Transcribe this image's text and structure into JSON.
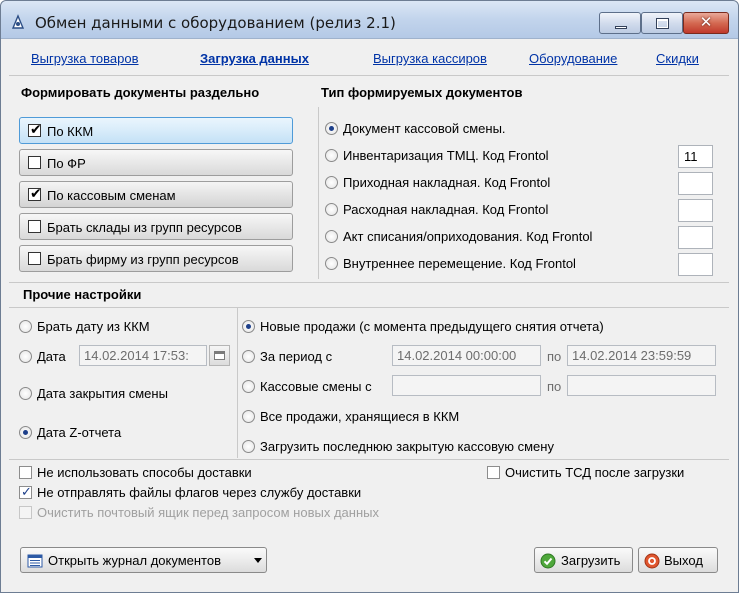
{
  "window": {
    "title": "Обмен данными с оборудованием (релиз 2.1)",
    "close_label": "✕"
  },
  "tabs": [
    {
      "label": "Выгрузка товаров",
      "active": false
    },
    {
      "label": "Загрузка данных",
      "active": true
    },
    {
      "label": "Выгрузка кассиров",
      "active": false
    },
    {
      "label": "Оборудование",
      "active": false
    },
    {
      "label": "Скидки",
      "active": false
    }
  ],
  "separate_docs": {
    "title": "Формировать документы раздельно",
    "options": [
      {
        "label": "По ККМ",
        "checked": true
      },
      {
        "label": "По ФР",
        "checked": false
      },
      {
        "label": "По кассовым сменам",
        "checked": true
      },
      {
        "label": "Брать склады из групп ресурсов",
        "checked": false
      },
      {
        "label": "Брать фирму из групп ресурсов",
        "checked": false
      }
    ],
    "check_mark": "✔"
  },
  "doc_types": {
    "title": "Тип формируемых документов",
    "options": [
      {
        "label": "Документ кассовой смены.",
        "selected": true,
        "code": null
      },
      {
        "label": "Инвентаризация ТМЦ. Код Frontol",
        "selected": false,
        "code": "11"
      },
      {
        "label": "Приходная накладная. Код Frontol",
        "selected": false,
        "code": ""
      },
      {
        "label": "Расходная накладная. Код Frontol",
        "selected": false,
        "code": ""
      },
      {
        "label": "Акт списания/оприходования. Код Frontol",
        "selected": false,
        "code": ""
      },
      {
        "label": "Внутреннее перемещение. Код Frontol",
        "selected": false,
        "code": ""
      }
    ]
  },
  "other": {
    "title": "Прочие настройки",
    "date_options": [
      {
        "label": "Брать дату из ККМ",
        "selected": false
      },
      {
        "label": "Дата",
        "selected": false
      },
      {
        "label": "Дата закрытия смены",
        "selected": false
      },
      {
        "label": "Дата Z-отчета",
        "selected": true
      }
    ],
    "date_value": "14.02.2014 17:53:",
    "sales_options": [
      {
        "label": "Новые продажи (с момента предыдущего снятия отчета)",
        "selected": true
      },
      {
        "label": "За период с",
        "selected": false
      },
      {
        "label": "Кассовые смены с",
        "selected": false
      },
      {
        "label": "Все продажи, хранящиеся в ККМ",
        "selected": false
      },
      {
        "label": "Загрузить последнюю закрытую кассовую смену",
        "selected": false
      }
    ],
    "period_from": "14.02.2014 00:00:00",
    "period_to": "14.02.2014 23:59:59",
    "shift_from": "",
    "shift_to": "",
    "po_label": "по"
  },
  "checks": {
    "no_delivery": {
      "label": "Не использовать способы доставки",
      "checked": false
    },
    "no_flags": {
      "label": "Не отправлять файлы флагов через службу доставки",
      "checked": true
    },
    "clear_mailbox": {
      "label": "Очистить почтовый ящик перед запросом новых данных",
      "checked": false,
      "disabled": true
    },
    "clear_tsd": {
      "label": "Очистить ТСД после загрузки",
      "checked": false
    },
    "check_mark": "✓"
  },
  "buttons": {
    "journal": "Открыть журнал документов",
    "load": "Загрузить",
    "exit": "Выход"
  }
}
